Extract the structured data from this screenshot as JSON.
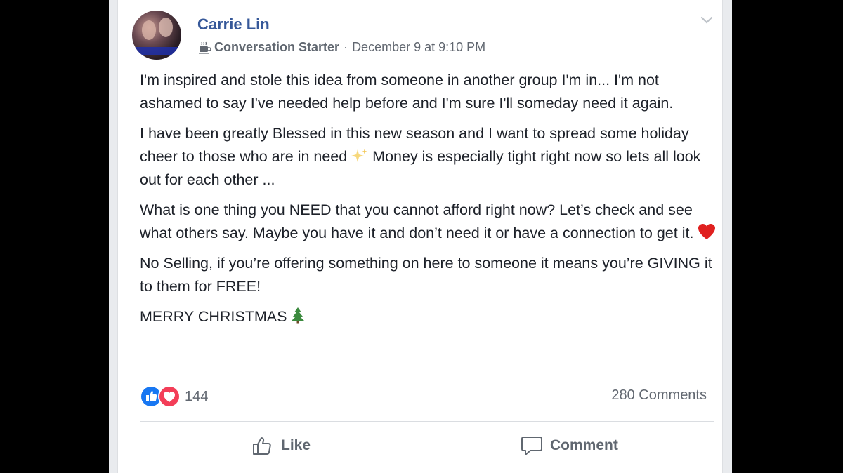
{
  "post": {
    "author": "Carrie Lin",
    "badge": "Conversation Starter",
    "separator": "·",
    "timestamp": "December 9 at 9:10 PM",
    "paragraphs": [
      {
        "text": "I'm inspired and stole this idea from someone in another group I'm in... I'm not ashamed to say I've needed help before and I'm sure I'll someday need it again."
      },
      {
        "text_before": "I have been greatly Blessed in this new season and I want to spread some holiday cheer to those who are in need ",
        "emoji": "sparkles",
        "text_after": " Money is especially tight right now so lets all look out for each other ..."
      },
      {
        "text_before": "What is one thing you NEED that you cannot afford right now? Let’s check and see what others say. Maybe you have it and don’t need it or have a connection to get it. ",
        "emoji": "red-heart"
      },
      {
        "text": "No Selling, if you’re offering something on here to someone it means you’re GIVING it to them for FREE!"
      },
      {
        "text_before": "MERRY CHRISTMAS ",
        "emoji": "christmas-tree"
      }
    ]
  },
  "reactions": {
    "types": [
      "like-reaction-icon",
      "love-reaction-icon"
    ],
    "count": "144"
  },
  "comments": {
    "count_label": "280 Comments"
  },
  "actions": {
    "like_label": "Like",
    "comment_label": "Comment"
  },
  "colors": {
    "author": "#365899",
    "meta": "#616770",
    "like_blue": "#1877f2",
    "love_red": "#f33e58",
    "card_bg": "#ffffff",
    "page_bg": "#000000"
  }
}
